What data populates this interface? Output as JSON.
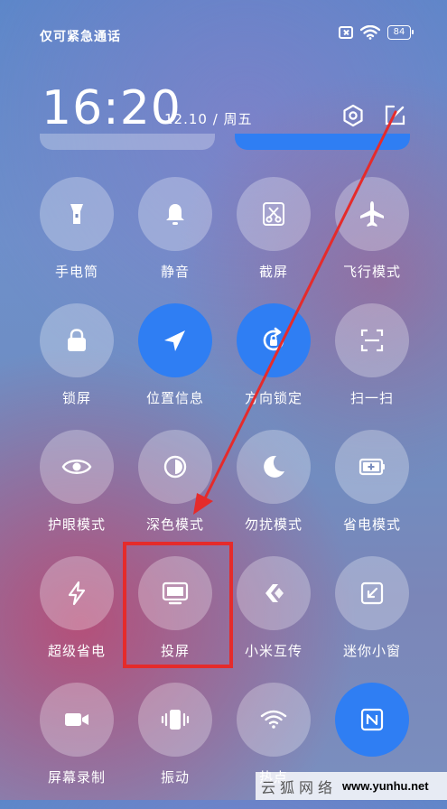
{
  "status": {
    "carrier": "仅可紧急通话",
    "battery": "84"
  },
  "header": {
    "time": "16:20",
    "date": "12.10 / 周五"
  },
  "tiles": [
    {
      "label": "手电筒",
      "icon": "flashlight-icon",
      "active": false
    },
    {
      "label": "静音",
      "icon": "bell-icon",
      "active": false
    },
    {
      "label": "截屏",
      "icon": "scissors-icon",
      "active": false
    },
    {
      "label": "飞行模式",
      "icon": "airplane-icon",
      "active": false
    },
    {
      "label": "锁屏",
      "icon": "lock-icon",
      "active": false
    },
    {
      "label": "位置信息",
      "icon": "location-arrow-icon",
      "active": true
    },
    {
      "label": "方向锁定",
      "icon": "rotation-lock-icon",
      "active": true
    },
    {
      "label": "扫一扫",
      "icon": "scan-icon",
      "active": false
    },
    {
      "label": "护眼模式",
      "icon": "eye-icon",
      "active": false
    },
    {
      "label": "深色模式",
      "icon": "dark-mode-icon",
      "active": false
    },
    {
      "label": "勿扰模式",
      "icon": "moon-icon",
      "active": false
    },
    {
      "label": "省电模式",
      "icon": "battery-saver-icon",
      "active": false
    },
    {
      "label": "超级省电",
      "icon": "lightning-icon",
      "active": false
    },
    {
      "label": "投屏",
      "icon": "monitor-icon",
      "active": false
    },
    {
      "label": "小米互传",
      "icon": "share-icon",
      "active": false
    },
    {
      "label": "迷你小窗",
      "icon": "mini-window-icon",
      "active": false
    },
    {
      "label": "屏幕录制",
      "icon": "video-camera-icon",
      "active": false
    },
    {
      "label": "振动",
      "icon": "vibrate-icon",
      "active": false
    },
    {
      "label": "热点",
      "icon": "hotspot-icon",
      "active": false
    },
    {
      "label": "",
      "icon": "nfc-icon",
      "active": true
    }
  ],
  "colors": {
    "accent": "#2f7ef3",
    "annotation": "#e52b2b"
  },
  "watermark": {
    "text_cn": "云狐网络",
    "url": "www.yunhu.net"
  }
}
